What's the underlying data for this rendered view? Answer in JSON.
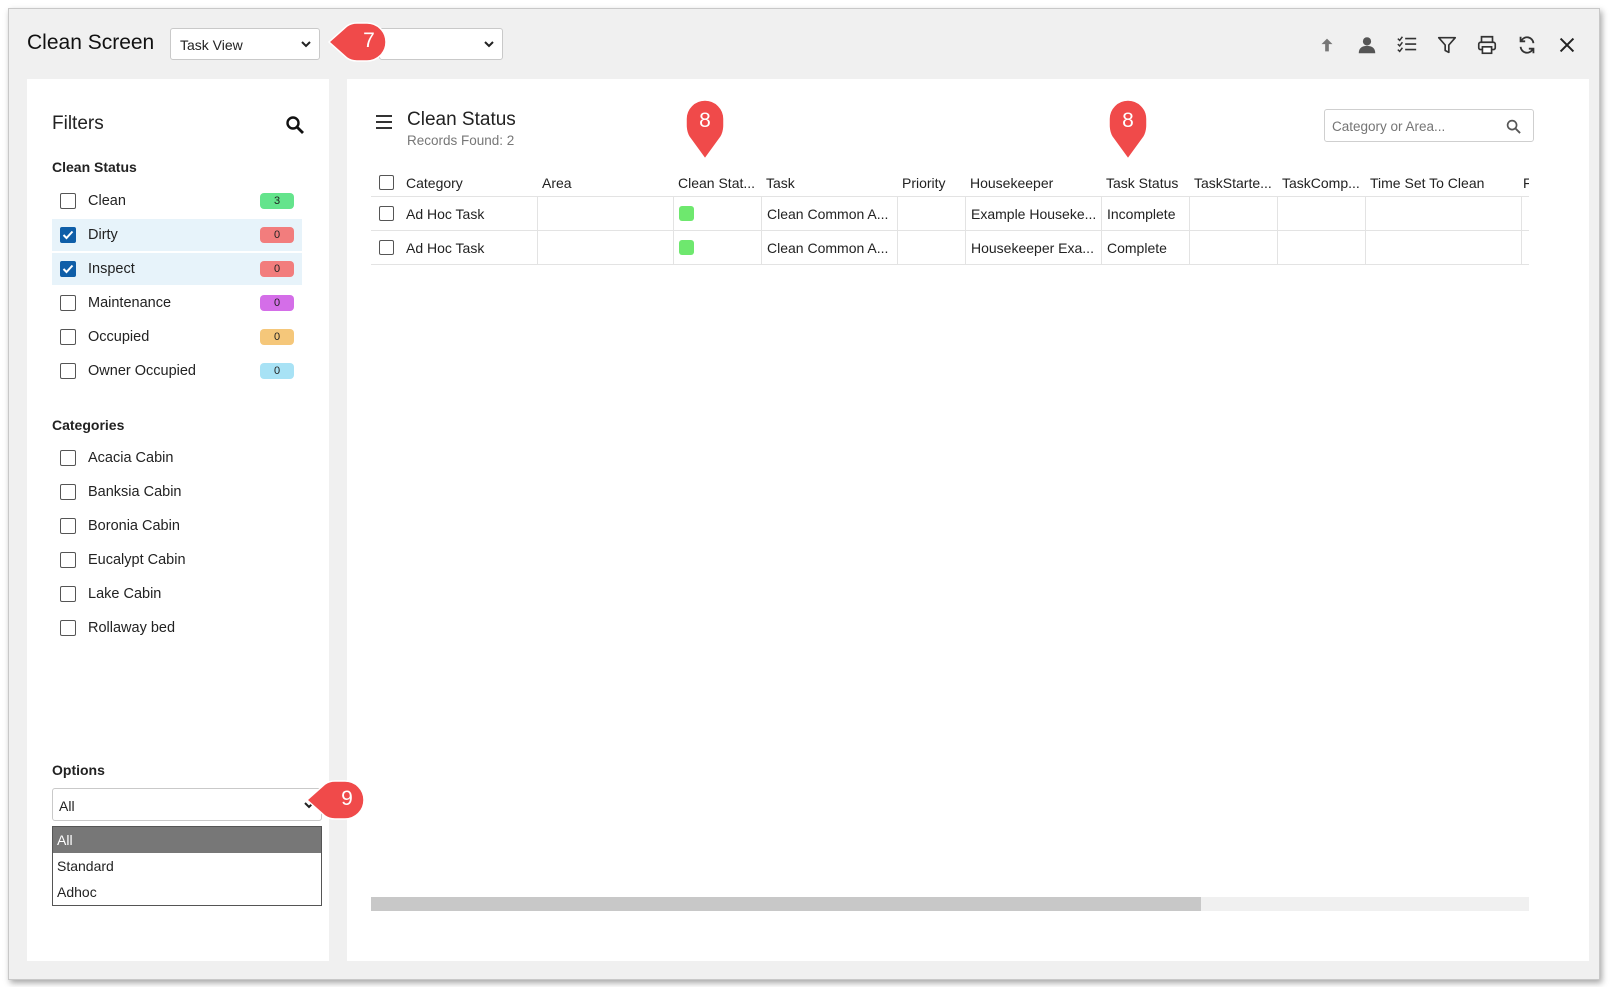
{
  "app": {
    "title": "Clean Screen"
  },
  "topbar": {
    "view_select": "Task View",
    "second_select": "",
    "toolbar_icons": [
      "arrow-up-icon",
      "user-icon",
      "checklist-icon",
      "filter-icon",
      "print-icon",
      "refresh-icon",
      "close-icon"
    ]
  },
  "filters": {
    "title": "Filters",
    "clean_status": {
      "title": "Clean Status",
      "items": [
        {
          "label": "Clean",
          "count": "3",
          "checked": false,
          "color": "#64e48c"
        },
        {
          "label": "Dirty",
          "count": "0",
          "checked": true,
          "color": "#f27d7d"
        },
        {
          "label": "Inspect",
          "count": "0",
          "checked": true,
          "color": "#f27d7d"
        },
        {
          "label": "Maintenance",
          "count": "0",
          "checked": false,
          "color": "#d46ee8"
        },
        {
          "label": "Occupied",
          "count": "0",
          "checked": false,
          "color": "#f5c77a"
        },
        {
          "label": "Owner Occupied",
          "count": "0",
          "checked": false,
          "color": "#a8e2f5"
        }
      ]
    },
    "categories": {
      "title": "Categories",
      "items": [
        "Acacia Cabin",
        "Banksia Cabin",
        "Boronia Cabin",
        "Eucalypt Cabin",
        "Lake Cabin",
        "Rollaway bed"
      ]
    },
    "options": {
      "title": "Options",
      "selected": "All",
      "list": [
        "All",
        "Standard",
        "Adhoc"
      ]
    }
  },
  "main": {
    "title": "Clean Status",
    "records": "Records Found: 2",
    "search_placeholder": "Category or Area...",
    "columns": [
      "Category",
      "Area",
      "Clean Stat...",
      "Task",
      "Priority",
      "Housekeeper",
      "Task Status",
      "TaskStarte...",
      "TaskComp...",
      "Time Set To Clean",
      "F"
    ],
    "rows": [
      {
        "category": "Ad Hoc Task",
        "area": "",
        "clean_status_color": "#6ee86e",
        "task": "Clean Common A...",
        "priority": "",
        "housekeeper": "Example Houseke...",
        "task_status": "Incomplete",
        "task_started": "",
        "task_completed": "",
        "time_set": ""
      },
      {
        "category": "Ad Hoc Task",
        "area": "",
        "clean_status_color": "#6ee86e",
        "task": "Clean Common A...",
        "priority": "",
        "housekeeper": "Housekeeper Exa...",
        "task_status": "Complete",
        "task_started": "",
        "task_completed": "",
        "time_set": ""
      }
    ]
  },
  "callouts": {
    "c7": "7",
    "c8a": "8",
    "c8b": "8",
    "c9": "9",
    "color": "#f04a4a"
  }
}
